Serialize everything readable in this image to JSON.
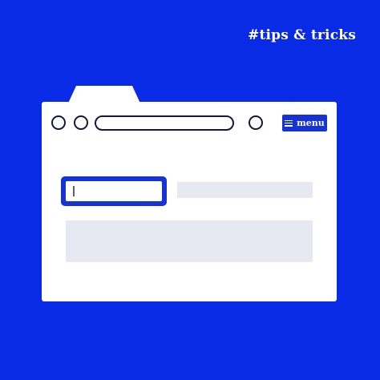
{
  "hashtag": "#tips & tricks",
  "browser": {
    "menu_label": "menu",
    "address_value": "",
    "input_value": ""
  },
  "colors": {
    "background": "#0a2be6",
    "accent": "#1633d6",
    "window": "#ffffff",
    "placeholder": "#e6e9f2",
    "outline": "#14183a"
  }
}
